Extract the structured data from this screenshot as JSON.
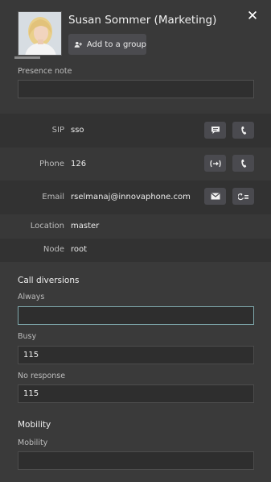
{
  "header": {
    "name": "Susan Sommer (Marketing)",
    "add_group_label": "Add to a group",
    "presence_note_label": "Presence note",
    "presence_note_value": ""
  },
  "info": {
    "sip_label": "SIP",
    "sip_value": "sso",
    "phone_label": "Phone",
    "phone_value": "126",
    "email_label": "Email",
    "email_value": "rselmanaj@innovaphone.com",
    "location_label": "Location",
    "location_value": "master",
    "node_label": "Node",
    "node_value": "root"
  },
  "diversions": {
    "title": "Call diversions",
    "always_label": "Always",
    "always_value": "",
    "busy_label": "Busy",
    "busy_value": "115",
    "noresponse_label": "No response",
    "noresponse_value": "115"
  },
  "mobility": {
    "title": "Mobility",
    "field_label": "Mobility",
    "field_value": ""
  },
  "icons": {
    "close": "close-icon",
    "add_group": "add-user-icon",
    "chat": "chat-icon",
    "call": "phone-icon",
    "transfer": "transfer-icon",
    "mail": "mail-icon",
    "history": "history-icon"
  },
  "colors": {
    "background": "#383838",
    "button": "#4a4a4f",
    "focus_border": "#7fa9ad"
  }
}
